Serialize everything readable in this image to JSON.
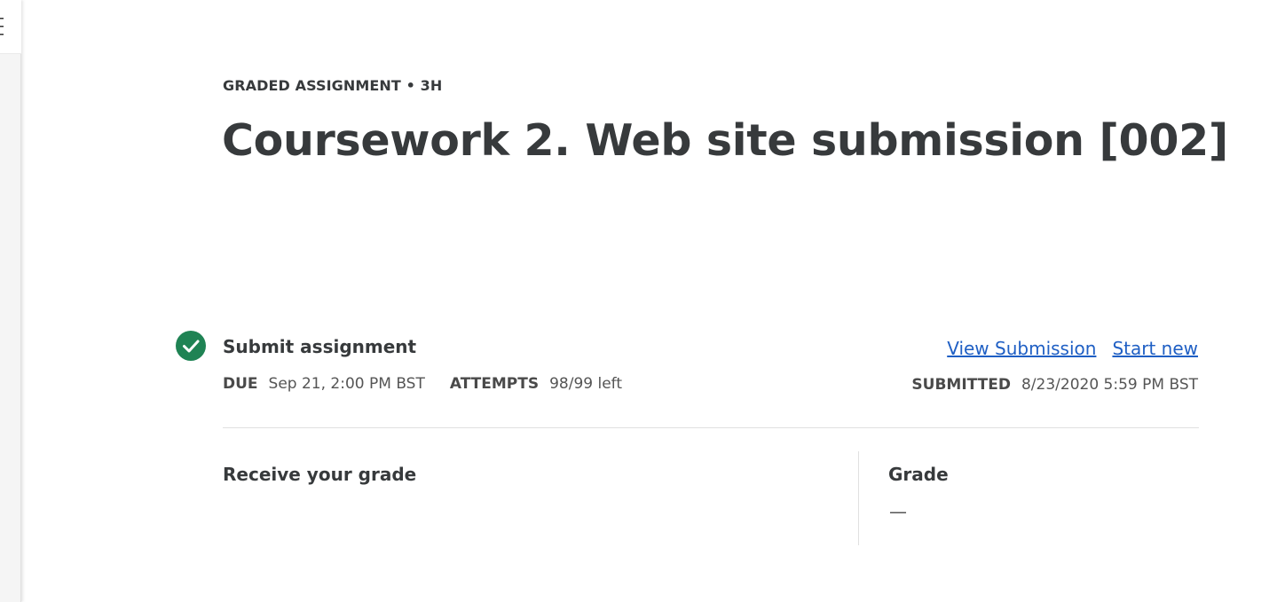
{
  "header": {
    "eyebrow": "GRADED ASSIGNMENT • 3H",
    "title": "Coursework 2. Web site submission [002]"
  },
  "step": {
    "title": "Submit assignment",
    "due_label": "DUE",
    "due_value": "Sep 21, 2:00 PM BST",
    "attempts_label": "ATTEMPTS",
    "attempts_value": "98/99 left",
    "status_icon": "check-circle-icon",
    "status_color": "#1f8354"
  },
  "actions": {
    "view_submission": "View Submission",
    "start_new": "Start new"
  },
  "submission": {
    "label": "SUBMITTED",
    "value": "8/23/2020 5:59 PM BST"
  },
  "grade_section": {
    "receive_label": "Receive your grade",
    "grade_label": "Grade",
    "grade_value": "—"
  },
  "colors": {
    "link": "#1f5fc4",
    "text": "#373a3c"
  }
}
